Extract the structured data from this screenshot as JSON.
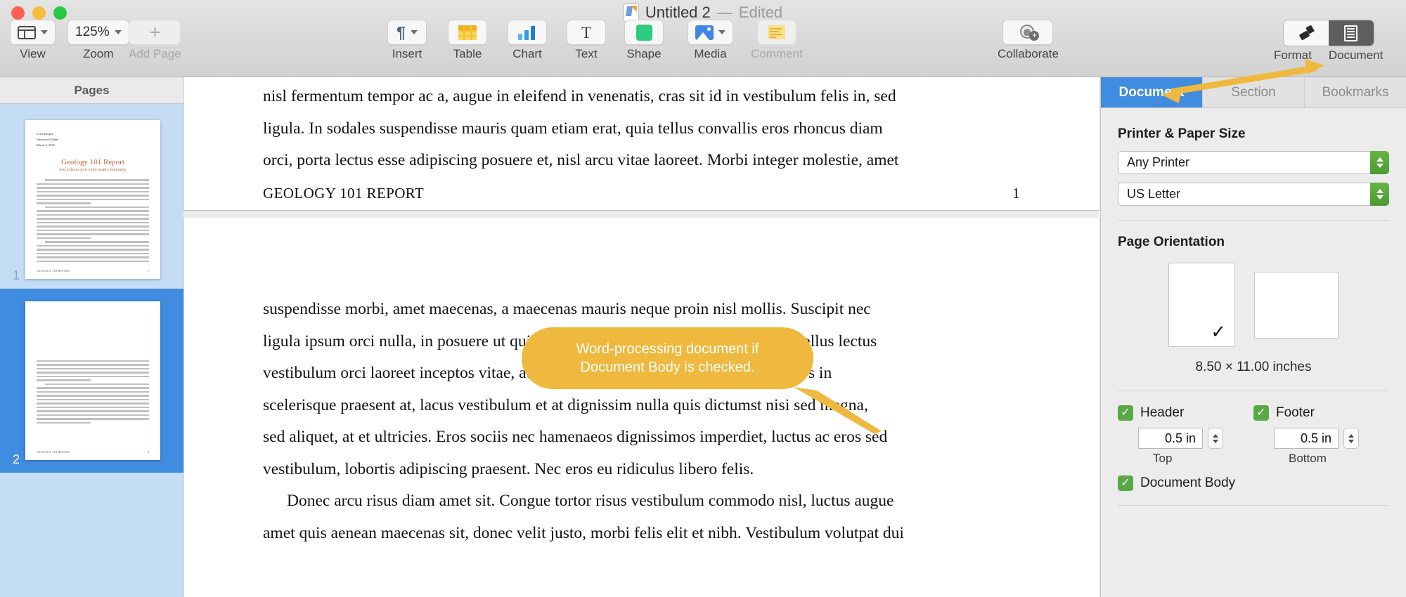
{
  "window": {
    "title": "Untitled 2",
    "separator": "—",
    "edited": "Edited",
    "app_icon": "pages-document-icon"
  },
  "toolbar": {
    "view": {
      "label": "View",
      "icon": "view-layout-icon"
    },
    "zoom": {
      "label": "Zoom",
      "value": "125%",
      "icon": "chevron-down-icon"
    },
    "add_page": {
      "label": "Add Page",
      "icon": "plus-icon"
    },
    "insert": {
      "label": "Insert",
      "icon": "pilcrow-icon"
    },
    "table": {
      "label": "Table",
      "icon": "table-icon"
    },
    "chart": {
      "label": "Chart",
      "icon": "bar-chart-icon"
    },
    "text": {
      "label": "Text",
      "icon": "text-t-icon"
    },
    "shape": {
      "label": "Shape",
      "icon": "shape-square-icon"
    },
    "media": {
      "label": "Media",
      "icon": "media-image-icon"
    },
    "comment": {
      "label": "Comment",
      "icon": "comment-note-icon"
    },
    "collaborate": {
      "label": "Collaborate",
      "icon": "add-person-icon"
    },
    "format": {
      "label": "Format",
      "icon": "paintbrush-icon"
    },
    "document": {
      "label": "Document",
      "icon": "document-panel-icon"
    }
  },
  "sidebar": {
    "header": "Pages",
    "pages": [
      {
        "number": "1",
        "selected": false,
        "meta": [
          "Urna Semper",
          "Instructor's Name",
          "March 6, 2019"
        ],
        "title": "Geology 101 Report",
        "subtitle": "Sed et lacus quis enim mattis nonummy",
        "footer": "GEOLOGY 101 REPORT",
        "footer_number": "1"
      },
      {
        "number": "2",
        "selected": true,
        "footer": "GEOLOGY 101 REPORT",
        "footer_number": "2"
      }
    ]
  },
  "document": {
    "page1_tail": [
      "nisl fermentum tempor ac a, augue in eleifend in venenatis, cras sit id in vestibulum felis in, sed",
      "ligula. In sodales suspendisse mauris quam etiam erat, quia tellus convallis eros rhoncus diam",
      "orci, porta lectus esse adipiscing posuere et, nisl arcu vitae laoreet. Morbi integer molestie, amet"
    ],
    "page1_footer_text": "GEOLOGY 101 REPORT",
    "page1_footer_number": "1",
    "page2_body": [
      "suspendisse morbi, amet maecenas, a maecenas mauris neque proin nisl mollis. Suscipit nec",
      "ligula ipsum orci nulla, in posuere ut quis ultrices, lectus primis vehicula velit hasellus lectus",
      "vestibulum orci laoreet inceptos vitae, at consectetur lorem quis nibh magna ut eros in",
      "scelerisque praesent at, lacus vestibulum et at dignissim nulla quis dictumst nisi sed magna,",
      "sed aliquet, at et ultricies. Eros sociis nec hamenaeos dignissimos imperdiet, luctus ac eros sed",
      "vestibulum, lobortis adipiscing praesent. Nec eros eu ridiculus libero felis."
    ],
    "page2_indent_paragraph": [
      "Donec arcu risus diam amet sit. Congue tortor risus vestibulum commodo nisl, luctus augue",
      "amet quis aenean maecenas sit, donec velit justo, morbi felis elit et nibh. Vestibulum volutpat dui"
    ]
  },
  "inspector": {
    "tabs": [
      {
        "label": "Document",
        "active": true
      },
      {
        "label": "Section",
        "active": false
      },
      {
        "label": "Bookmarks",
        "active": false
      }
    ],
    "printer_paper": {
      "label": "Printer & Paper Size",
      "printer": "Any Printer",
      "paper_size": "US Letter"
    },
    "page_orientation": {
      "label": "Page Orientation",
      "portrait_selected": true,
      "landscape_selected": false,
      "checkmark": "✓",
      "dimensions": "8.50 × 11.00 inches"
    },
    "header_footer": {
      "header": {
        "label": "Header",
        "checked": true,
        "value": "0.5 in",
        "sub_label": "Top"
      },
      "footer": {
        "label": "Footer",
        "checked": true,
        "value": "0.5 in",
        "sub_label": "Bottom"
      },
      "document_body": {
        "label": "Document Body",
        "checked": true
      },
      "check_glyph": "✓"
    }
  },
  "annotation": {
    "callout_text": "Word-processing document if Document Body is checked.",
    "callout_color": "#efb93f",
    "arrow_color": "#efb93f"
  }
}
